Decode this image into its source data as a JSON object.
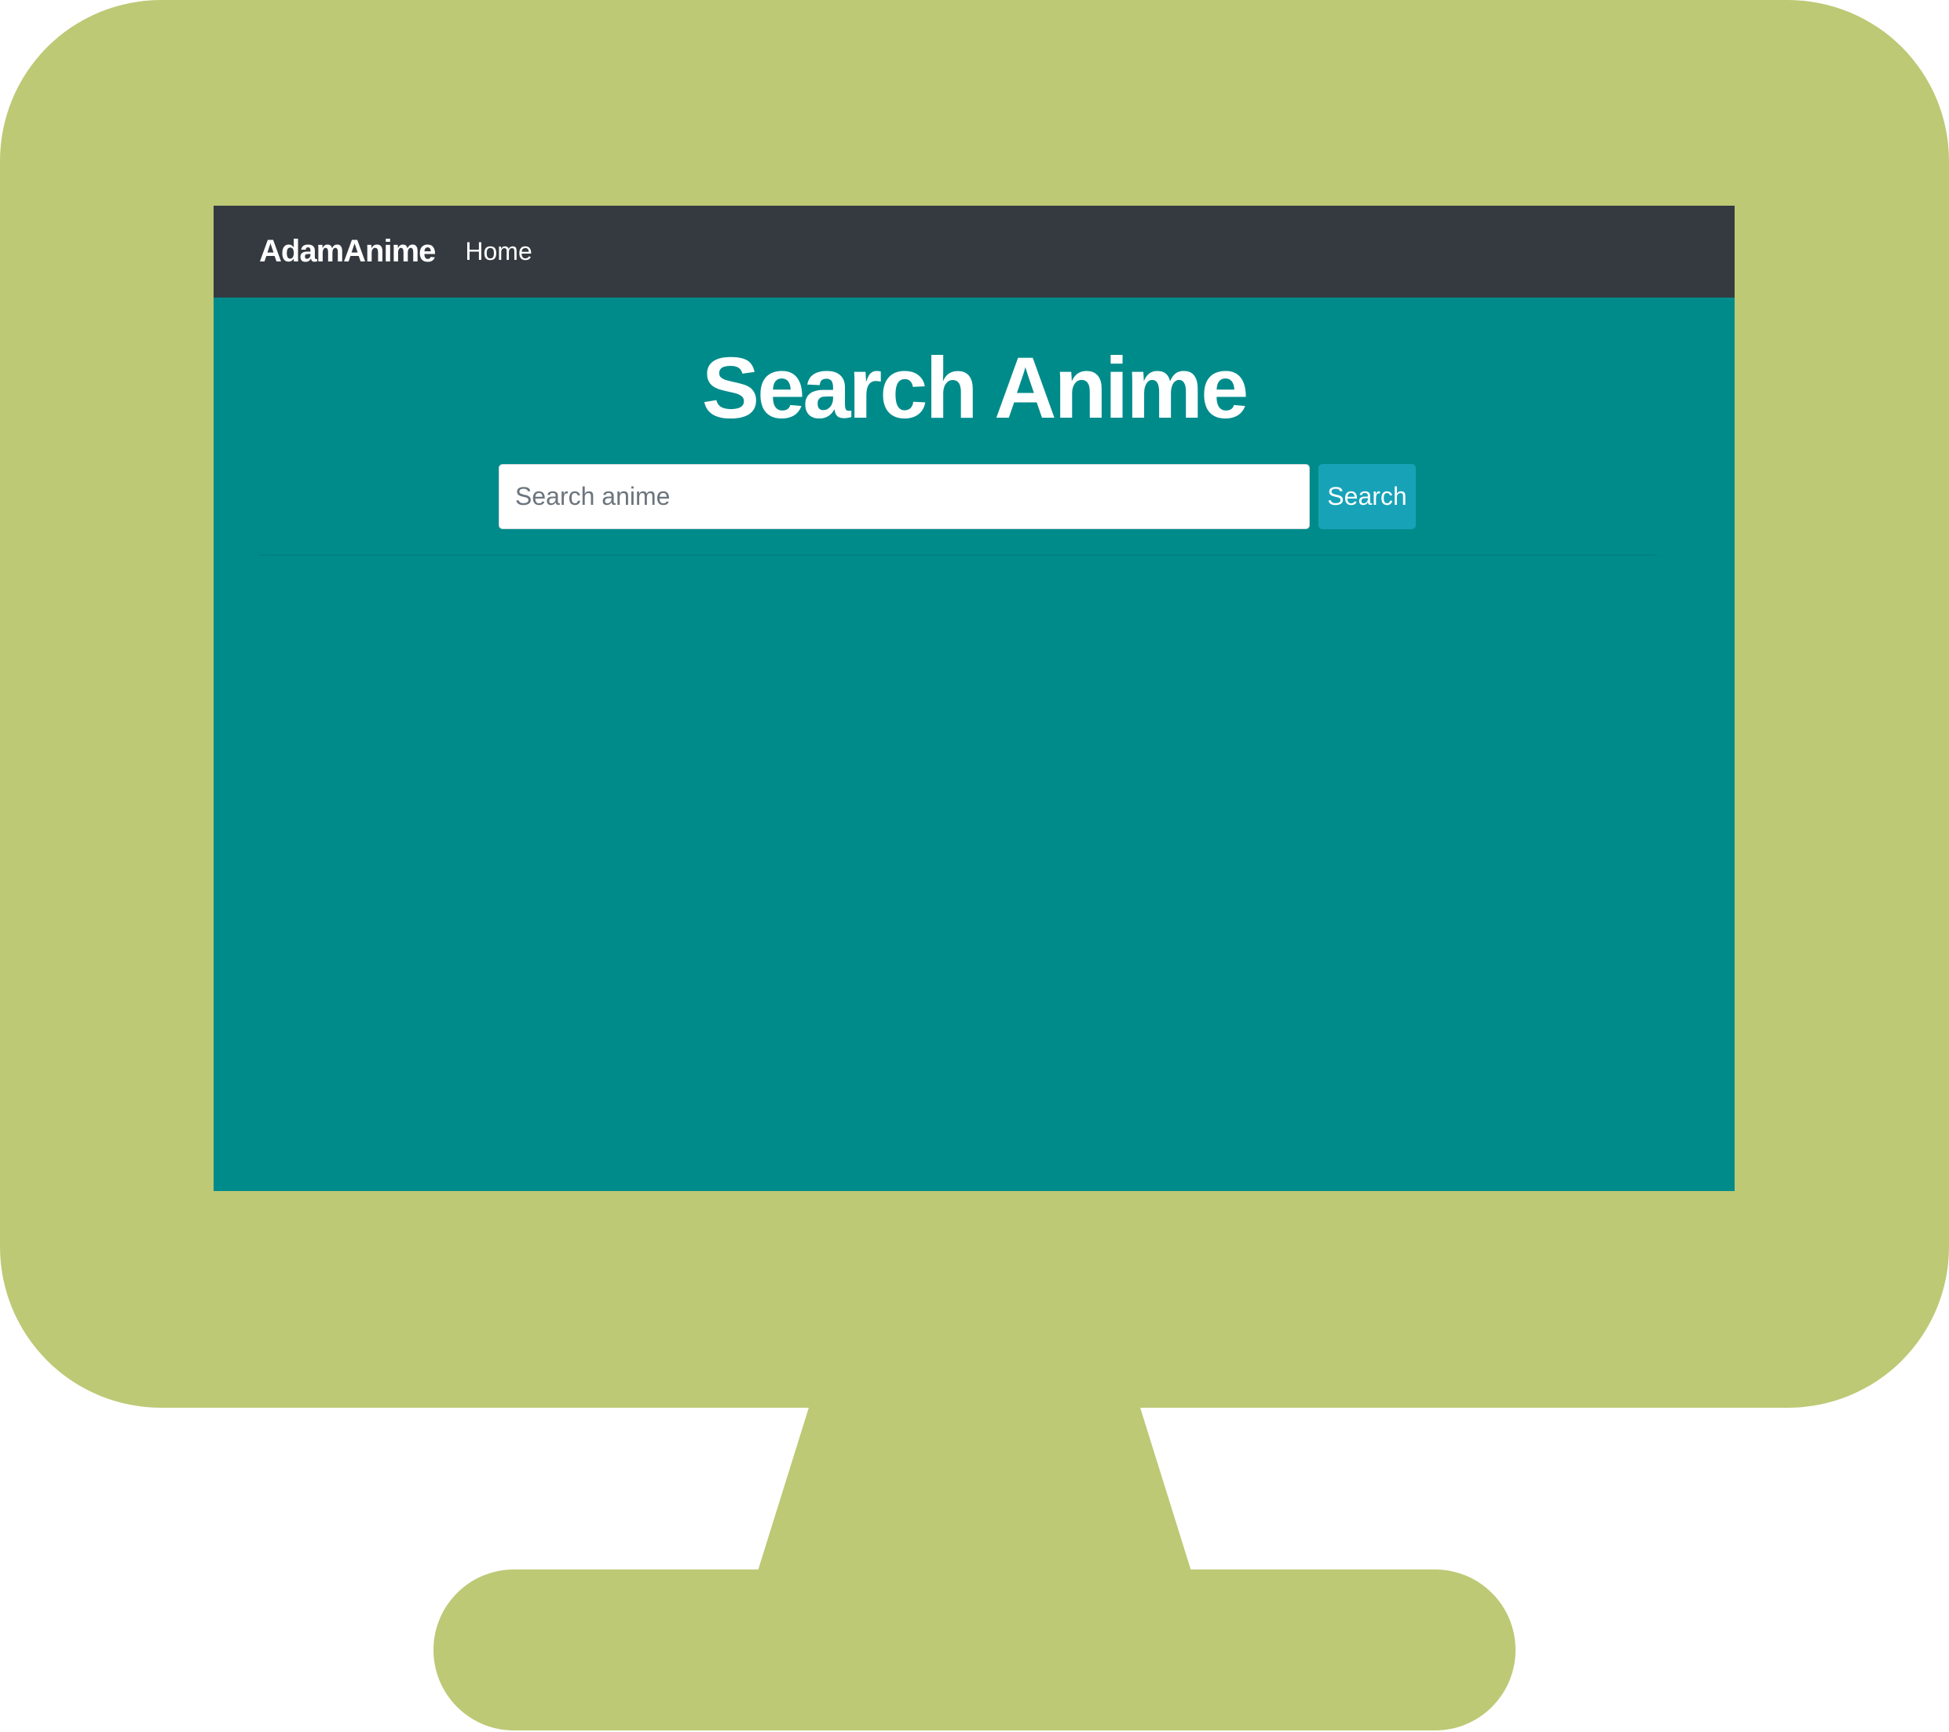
{
  "colors": {
    "frame": "#BDC975",
    "nav_bg": "#343A40",
    "page_bg": "#008B8B",
    "button_bg": "#17A2B8"
  },
  "navbar": {
    "brand": "AdamAnime",
    "links": [
      "Home"
    ]
  },
  "main": {
    "title": "Search Anime",
    "search": {
      "placeholder": "Search anime",
      "value": "",
      "button_label": "Search"
    }
  }
}
